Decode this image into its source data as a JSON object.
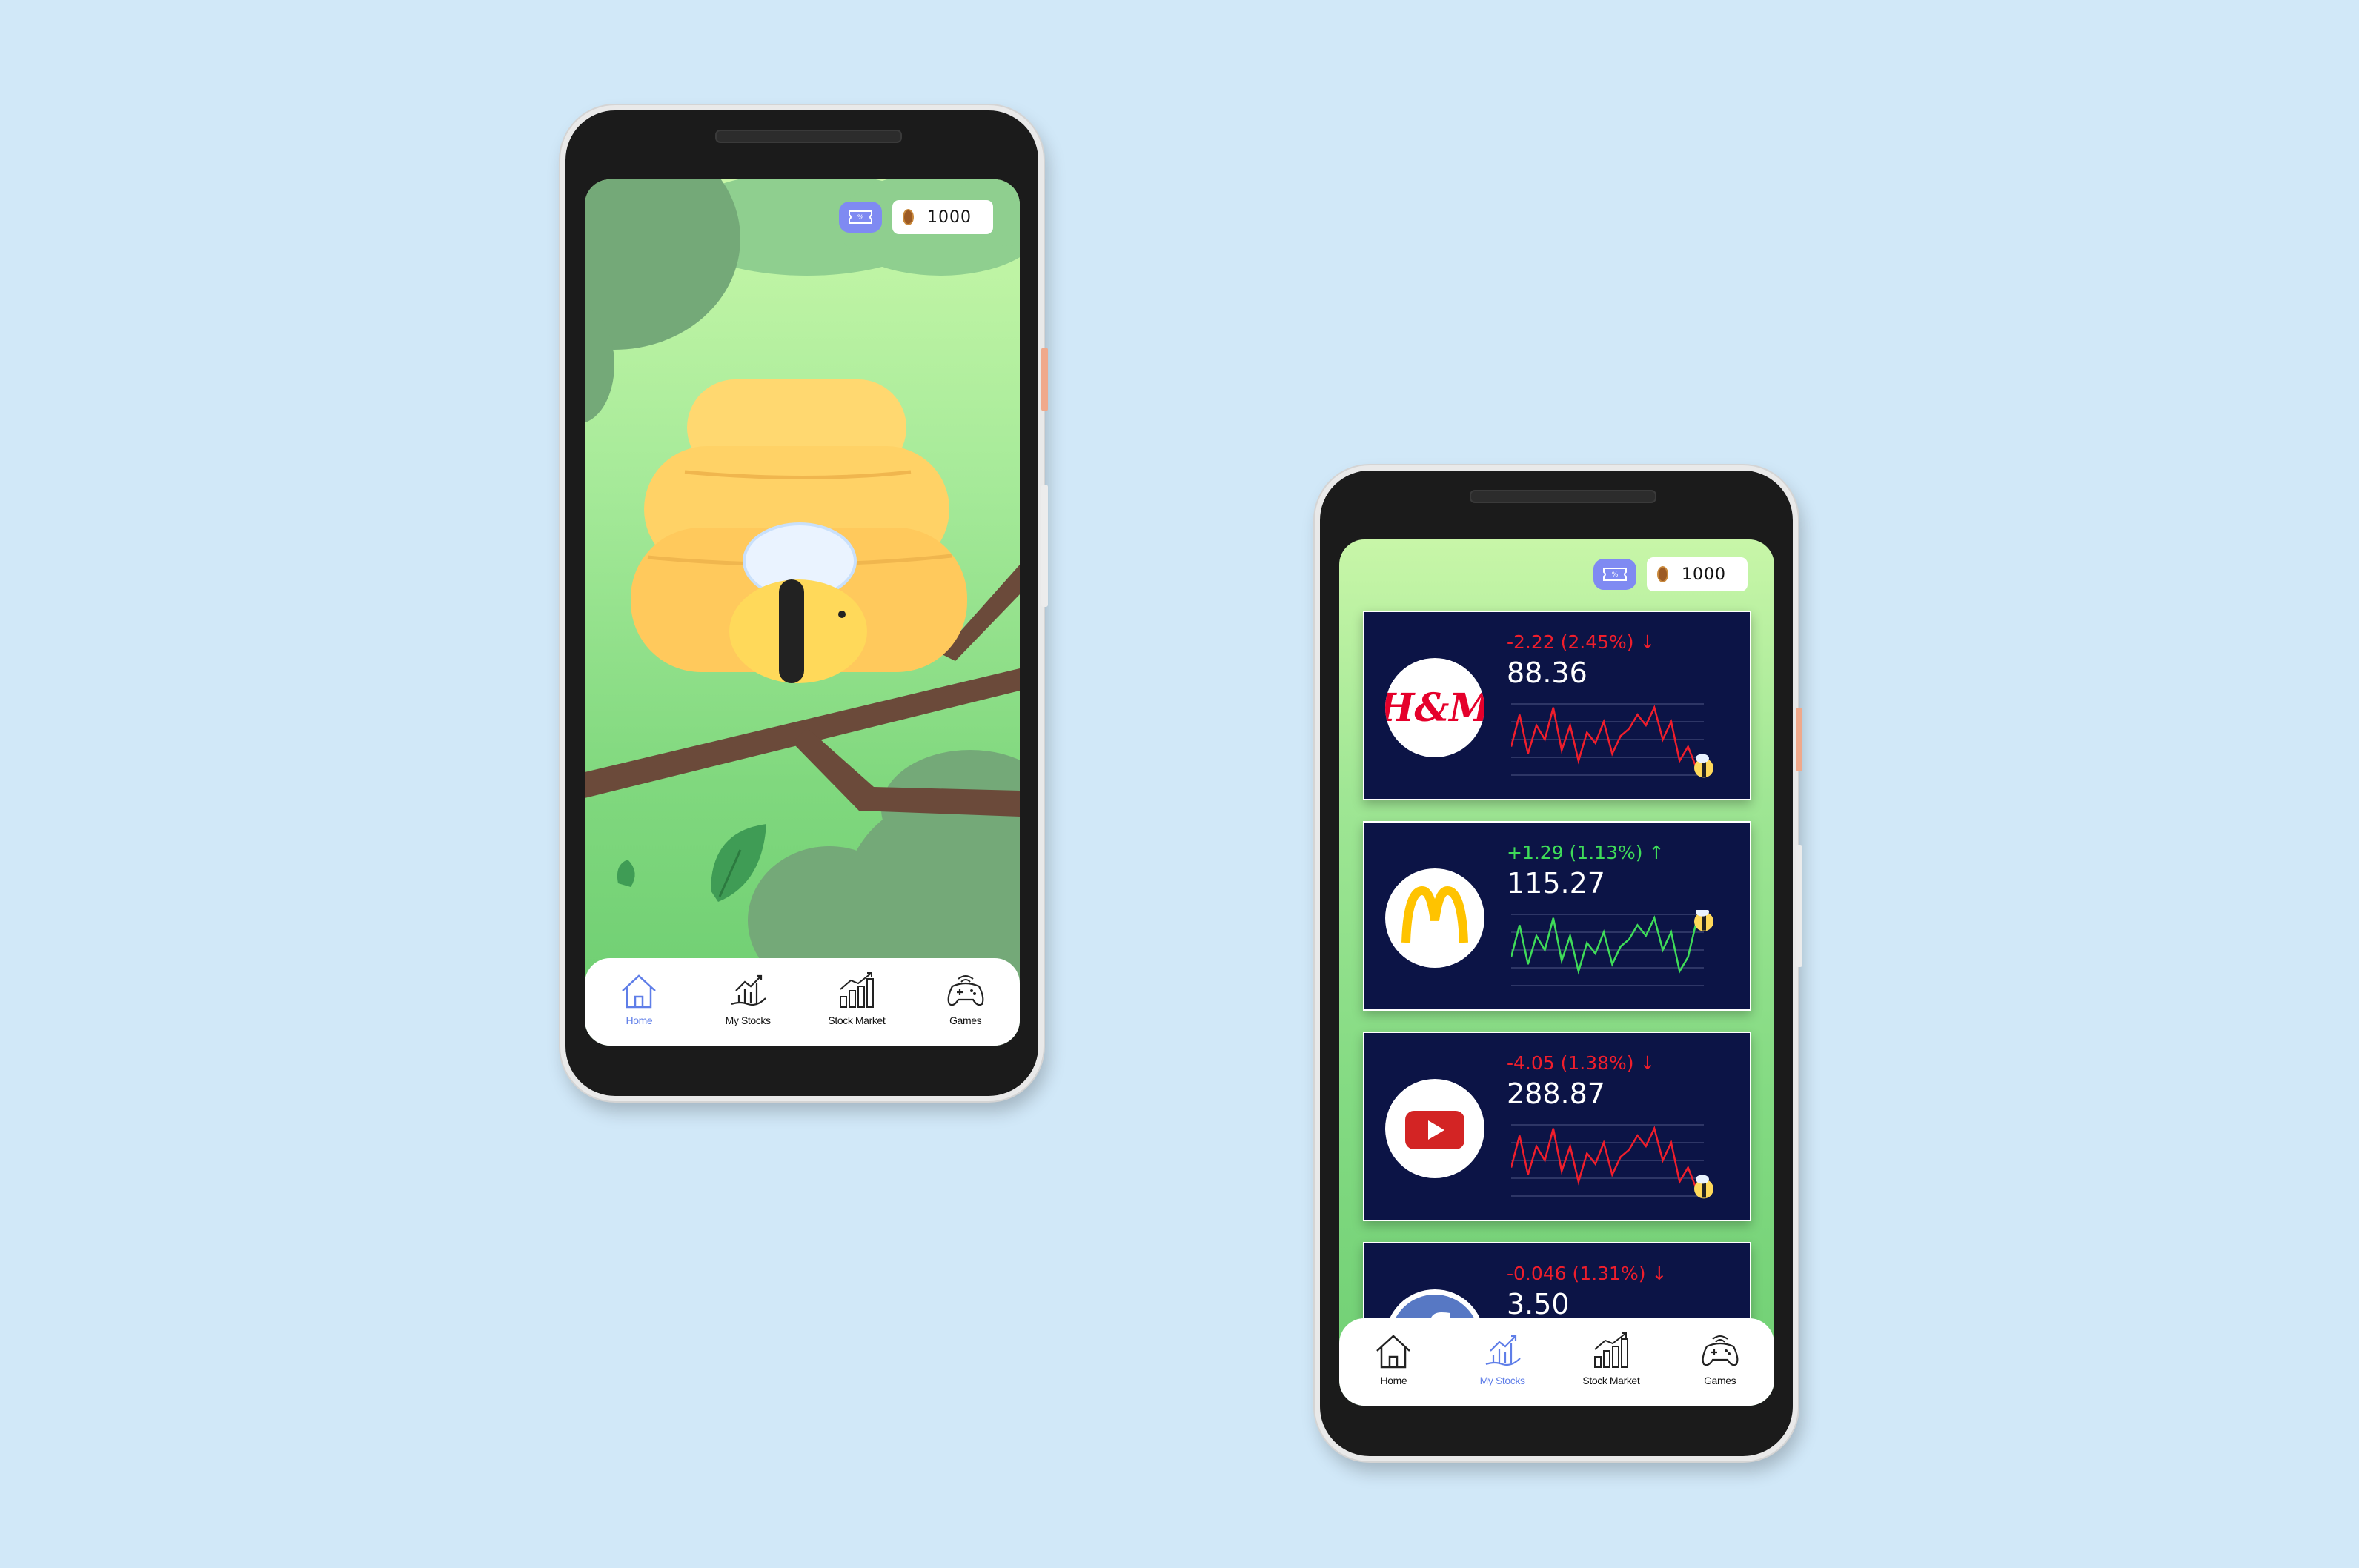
{
  "currency": {
    "ticket_icon": "discount-ticket-icon",
    "coin_icon": "seed-coin-icon",
    "amount": "1000"
  },
  "nav": {
    "items": [
      {
        "label": "Home",
        "icon": "home-icon"
      },
      {
        "label": "My Stocks",
        "icon": "growth-chart-hand-icon"
      },
      {
        "label": "Stock Market",
        "icon": "bar-chart-icon"
      },
      {
        "label": "Games",
        "icon": "gamepad-icon"
      }
    ]
  },
  "home_screen": {
    "active_tab": "Home"
  },
  "stocks_screen": {
    "active_tab": "My Stocks",
    "stocks": [
      {
        "logo": "H&M",
        "change": "-2.22 (2.45%)",
        "direction": "down",
        "price": "88.36",
        "trend": [
          0.4,
          0.85,
          0.3,
          0.7,
          0.5,
          0.95,
          0.35,
          0.7,
          0.2,
          0.6,
          0.45,
          0.75,
          0.3,
          0.55,
          0.65,
          0.85,
          0.7,
          0.95,
          0.5,
          0.75,
          0.2,
          0.4,
          0.1
        ]
      },
      {
        "logo": "McDonald's",
        "change": "+1.29 (1.13%)",
        "direction": "up",
        "price": "115.27",
        "trend": [
          0.4,
          0.85,
          0.3,
          0.7,
          0.5,
          0.95,
          0.35,
          0.7,
          0.2,
          0.6,
          0.45,
          0.75,
          0.3,
          0.55,
          0.65,
          0.85,
          0.7,
          0.95,
          0.5,
          0.75,
          0.2,
          0.4,
          0.9
        ]
      },
      {
        "logo": "YouTube",
        "change": "-4.05 (1.38%)",
        "direction": "down",
        "price": "288.87",
        "trend": [
          0.4,
          0.85,
          0.3,
          0.7,
          0.5,
          0.95,
          0.35,
          0.7,
          0.2,
          0.6,
          0.45,
          0.75,
          0.3,
          0.55,
          0.65,
          0.85,
          0.7,
          0.95,
          0.5,
          0.75,
          0.2,
          0.4,
          0.1
        ]
      },
      {
        "logo": "Facebook",
        "change": "-0.046 (1.31%)",
        "direction": "down",
        "price": "3.50",
        "trend": []
      }
    ]
  },
  "colors": {
    "down": "#f01e2c",
    "up": "#3fdc59",
    "card_bg": "#0c1446",
    "nav_active": "#5f7ee8",
    "ticket": "#7f8af2"
  }
}
